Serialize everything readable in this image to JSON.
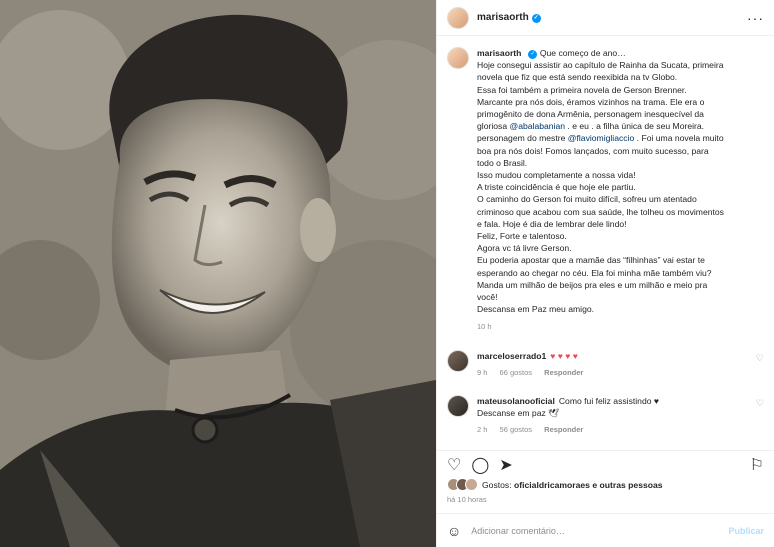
{
  "post": {
    "username": "marisaorth",
    "more_icon": "more-dots-icon",
    "caption_lines": [
      "Que começo de ano…",
      "Hoje consegui assistir ao capítulo de Rainha da Sucata, primeira",
      "novela que fiz que está sendo reexibida na tv Globo.",
      "Essa foi também a primeira novela de Gerson Brenner.",
      "Marcante pra nós dois, éramos vizinhos na trama. Ele era o",
      "primogênito de dona Armênia, personagem inesquecível da",
      "gloriosa @abalabanian . e eu . a filha única de seu Moreira.",
      "personagem do mestre @flaviomigliaccio . Foi uma novela muito",
      "boa pra nós dois! Fomos lançados, com muito sucesso, para",
      "todo o Brasil.",
      "Isso mudou completamente a nossa vida!",
      "A triste coincidência é que hoje ele partiu.",
      "O caminho do Gerson foi muito difícil, sofreu um atentado",
      "criminoso que acabou com sua saúde, lhe tolheu os movimentos",
      "e fala. Hoje é dia de lembrar dele lindo!",
      "Feliz, Forte e talentoso.",
      "Agora vc tá livre Gerson.",
      "Eu poderia apostar que a mamãe das “filhinhas” vai estar te",
      "esperando ao chegar no céu. Ela foi minha mãe também viu?",
      "Manda um milhão de beijos pra eles e um milhão e meio pra",
      "você!",
      "Descansa em Paz meu amigo."
    ],
    "caption_time": "10 h"
  },
  "comments": [
    {
      "username": "marceloserrado1",
      "text": "♥ ♥ ♥ ♥",
      "time": "9 h",
      "likes": "66 gostos",
      "reply": "Responder"
    },
    {
      "username": "mateusolanooficial",
      "text": "Como fui feliz assistindo ♥",
      "text2": "Descanse em paz 🕊",
      "time": "2 h",
      "likes": "56 gostos",
      "reply": "Responder"
    }
  ],
  "likes": {
    "prefix": "Gostos: ",
    "user": "oficialdricamoraes",
    "suffix": " e outras pessoas",
    "ago": "há 10 horas"
  },
  "add_comment": {
    "placeholder": "Adicionar comentário…",
    "publish": "Publicar"
  }
}
